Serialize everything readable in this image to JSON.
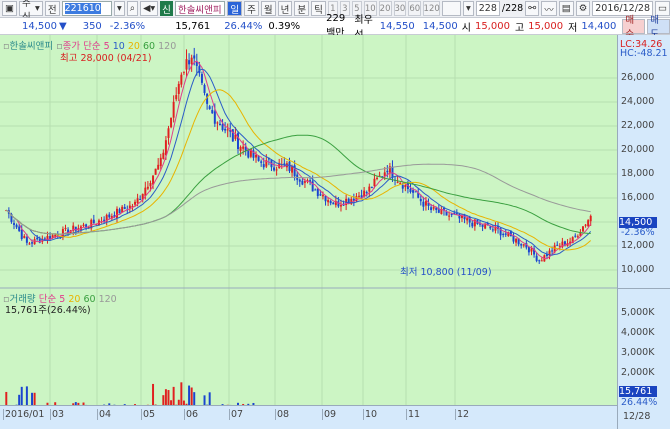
{
  "toolbar": {
    "market": "주식",
    "market_prev": "전",
    "code": "221610",
    "stock_name": "한솔씨앤피",
    "new_badge": "신",
    "periods": [
      "일",
      "주",
      "월",
      "년",
      "분",
      "틱"
    ],
    "selected_period": "일",
    "minutes": [
      "1",
      "3",
      "5",
      "10",
      "20",
      "30",
      "60",
      "120"
    ],
    "count": "228",
    "total": "/228",
    "date": "2016/12/28"
  },
  "quote": {
    "price": "14,500",
    "change_arrow": "▼",
    "change": "350",
    "change_pct": "-2.36%",
    "volume": "15,761",
    "volume_pct": "26.44%",
    "turnover": "0.39%",
    "trade_value": "229백만",
    "best_label": "최우선",
    "ask": "14,550",
    "bid": "14,500",
    "open_label": "시",
    "open": "15,000",
    "high_label": "고",
    "high": "15,000",
    "low_label": "저",
    "low": "14,400",
    "buy": "매수",
    "sell": "매도"
  },
  "price_pane": {
    "name": "한솔씨앤피",
    "ma_label": "종가 단순",
    "ma_periods": [
      "5",
      "10",
      "20",
      "60",
      "120"
    ],
    "ma_colors": [
      "#e03c8c",
      "#2a5cc8",
      "#e8b400",
      "#3aa040",
      "#999999"
    ],
    "high_note": "최고 28,000 (04/21)",
    "low_note": "최저 10,800 (11/09)",
    "lc": "LC:34.26",
    "hc": "HC:-48.21",
    "y_ticks": [
      "26,000",
      "24,000",
      "22,000",
      "20,000",
      "18,000",
      "16,000",
      "12,000",
      "10,000"
    ],
    "last_price": "14,500",
    "last_pct": "-2.36%"
  },
  "volume_pane": {
    "name": "거래량",
    "ma_label": "단순",
    "ma_periods": [
      "5",
      "20",
      "60",
      "120"
    ],
    "current": "15,761주(26.44%)",
    "y_ticks": [
      "5,000K",
      "4,000K",
      "3,000K",
      "2,000K",
      "1,000K"
    ],
    "last_volume": "15,761",
    "last_pct": "26.44%"
  },
  "x_axis": {
    "labels": [
      "2016/01",
      "03",
      "04",
      "05",
      "06",
      "07",
      "08",
      "09",
      "10",
      "11",
      "12"
    ],
    "end_label": "12/28"
  },
  "chart_data": {
    "type": "candlestick",
    "x_labels": [
      "2016/01",
      "03",
      "04",
      "05",
      "06",
      "07",
      "08",
      "09",
      "10",
      "11",
      "12"
    ],
    "approx_close_path": [
      [
        0,
        15000
      ],
      [
        8,
        12200
      ],
      [
        20,
        13000
      ],
      [
        35,
        14000
      ],
      [
        50,
        15500
      ],
      [
        60,
        19000
      ],
      [
        68,
        26500
      ],
      [
        72,
        28000
      ],
      [
        78,
        23500
      ],
      [
        88,
        21000
      ],
      [
        98,
        19000
      ],
      [
        110,
        18500
      ],
      [
        118,
        17000
      ],
      [
        128,
        15500
      ],
      [
        140,
        16500
      ],
      [
        148,
        18500
      ],
      [
        155,
        17000
      ],
      [
        165,
        15000
      ],
      [
        180,
        14000
      ],
      [
        192,
        13200
      ],
      [
        202,
        12000
      ],
      [
        207,
        10800
      ],
      [
        214,
        12000
      ],
      [
        220,
        12500
      ],
      [
        227,
        14500
      ]
    ],
    "ylim": [
      10000,
      27000
    ],
    "volume_ylim_k": [
      0,
      5500
    ]
  }
}
